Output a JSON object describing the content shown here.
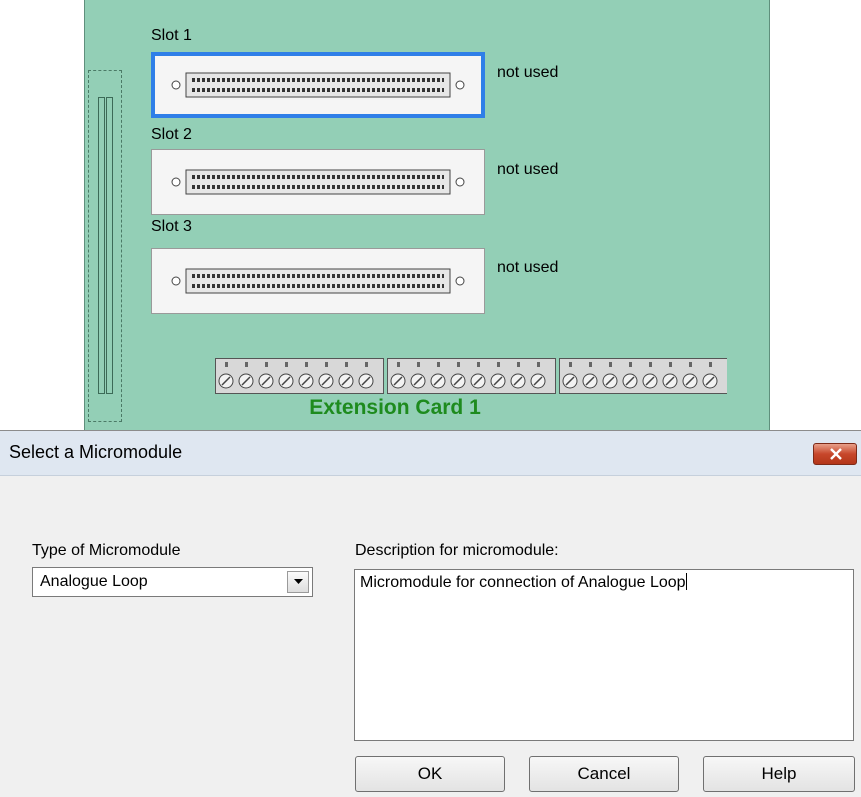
{
  "card": {
    "title": "Extension Card 1",
    "slots": [
      {
        "label": "Slot 1",
        "status": "not used",
        "selected": true
      },
      {
        "label": "Slot 2",
        "status": "not used",
        "selected": false
      },
      {
        "label": "Slot 3",
        "status": "not used",
        "selected": false
      }
    ]
  },
  "dialog": {
    "title": "Select a Micromodule",
    "type_label": "Type of Micromodule",
    "type_value": "Analogue Loop",
    "description_label": "Description for micromodule:",
    "description_value": "Micromodule for connection of Analogue Loop",
    "buttons": {
      "ok": "OK",
      "cancel": "Cancel",
      "help": "Help"
    }
  },
  "colors": {
    "card_background": "#93cfb6",
    "card_title": "#1e8b1e",
    "selection_border": "#2f7fe8",
    "close_button": "#c7472b"
  }
}
